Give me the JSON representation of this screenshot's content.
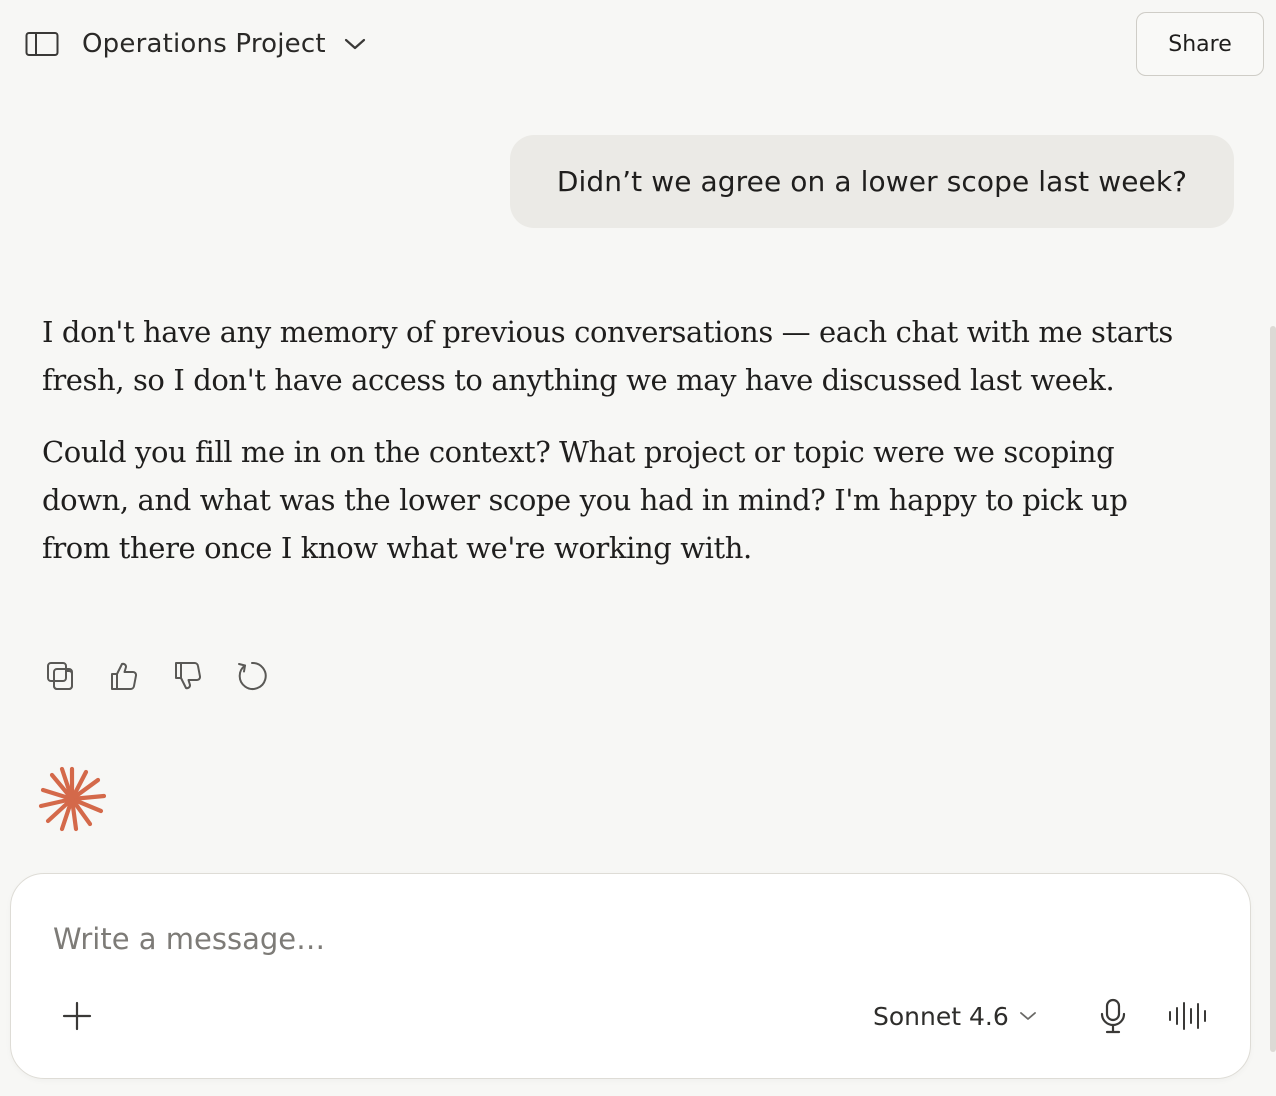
{
  "header": {
    "project_title": "Operations Project",
    "share_label": "Share"
  },
  "conversation": {
    "user_message": "Didn’t we agree on a lower scope last week?",
    "assistant_paragraphs": [
      "I don't have any memory of previous conversations — each chat with me starts fresh, so I don't have access to anything we may have discussed last week.",
      "Could you fill me in on the context? What project or topic were we scoping down, and what was the lower scope you had in mind? I'm happy to pick up from there once I know what we're working with."
    ],
    "actions": [
      "copy-icon",
      "thumbs-up-icon",
      "thumbs-down-icon",
      "retry-icon"
    ]
  },
  "composer": {
    "placeholder": "Write a message…",
    "model_label": "Sonnet 4.6"
  },
  "colors": {
    "background": "#f7f7f5",
    "user_bubble": "#ebeae6",
    "brand_accent": "#d4694a",
    "composer_bg": "#ffffff"
  },
  "icons": {
    "sidebar_toggle": "sidebar-toggle-icon",
    "title_dropdown": "chevron-down-icon",
    "logo": "spark-logo-icon",
    "add": "plus-icon",
    "model_dropdown": "chevron-down-icon",
    "mic": "microphone-icon",
    "voice": "voice-waveform-icon"
  }
}
